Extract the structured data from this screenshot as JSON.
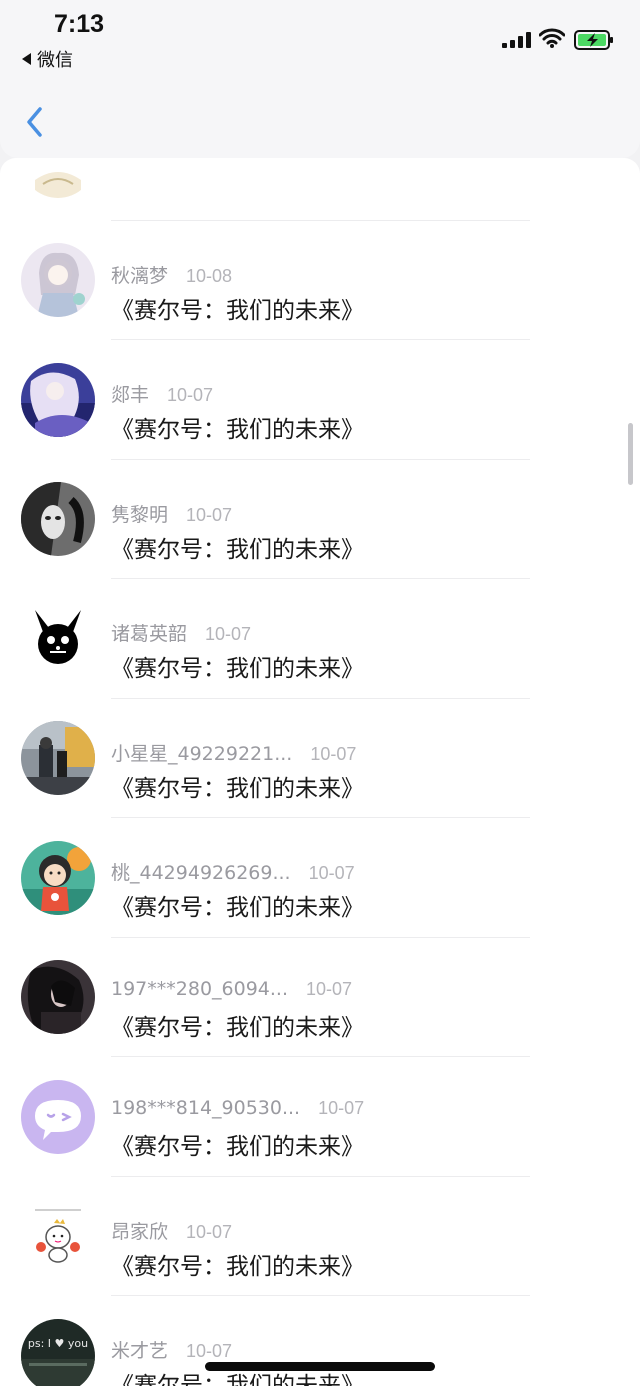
{
  "status": {
    "time": "7:13",
    "back_app": "微信"
  },
  "rows": [
    {
      "name": "",
      "date": "",
      "msg": ""
    },
    {
      "name": "秋漓梦",
      "date": "10-08",
      "msg": "《赛尔号：我们的未来》"
    },
    {
      "name": "郯丰",
      "date": "10-07",
      "msg": "《赛尔号：我们的未来》"
    },
    {
      "name": "隽黎明",
      "date": "10-07",
      "msg": "《赛尔号：我们的未来》"
    },
    {
      "name": "诸葛英韶",
      "date": "10-07",
      "msg": "《赛尔号：我们的未来》"
    },
    {
      "name": "小星星_49229221...",
      "date": "10-07",
      "msg": "《赛尔号：我们的未来》"
    },
    {
      "name": "桃_44294926269...",
      "date": "10-07",
      "msg": "《赛尔号：我们的未来》"
    },
    {
      "name": "197***280_6094...",
      "date": "10-07",
      "msg": "《赛尔号：我们的未来》"
    },
    {
      "name": "198***814_90530...",
      "date": "10-07",
      "msg": "《赛尔号：我们的未来》"
    },
    {
      "name": "昂家欣",
      "date": "10-07",
      "msg": "《赛尔号：我们的未来》"
    },
    {
      "name": "米才艺",
      "date": "10-07",
      "msg": "《赛尔号：我们的未来》"
    }
  ],
  "avatar_labels": {
    "米才艺": "ps: I ♥ you"
  },
  "colors": {
    "back_blue": "#4a90e2",
    "battery_green": "#4cd964",
    "name_gray": "#9a9aa0",
    "date_gray": "#b4b4b9"
  }
}
